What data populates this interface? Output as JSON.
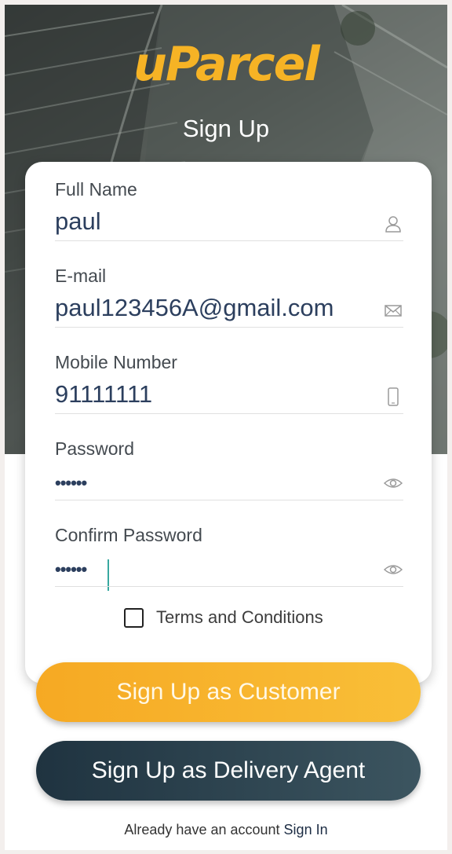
{
  "header": {
    "logo_text": "uParcel",
    "title": "Sign Up"
  },
  "form": {
    "full_name": {
      "label": "Full Name",
      "value": "paul",
      "icon": "user-icon"
    },
    "email": {
      "label": "E-mail",
      "value": "paul123456A@gmail.com",
      "icon": "envelope-icon"
    },
    "mobile": {
      "label": "Mobile Number",
      "value": "91111111",
      "icon": "phone-icon"
    },
    "password": {
      "label": "Password",
      "value": "••••••",
      "icon": "eye-icon"
    },
    "confirm_password": {
      "label": "Confirm Password",
      "value": "••••••",
      "icon": "eye-icon"
    },
    "terms_label": "Terms and Conditions"
  },
  "buttons": {
    "customer": "Sign Up as Customer",
    "agent": "Sign Up as Delivery Agent"
  },
  "footer": {
    "prompt": "Already have an account",
    "sign_in": "Sign In"
  },
  "colors": {
    "brand_orange": "#f6b325",
    "agent_button": "#2a4250",
    "input_text": "#2c3f5e"
  }
}
